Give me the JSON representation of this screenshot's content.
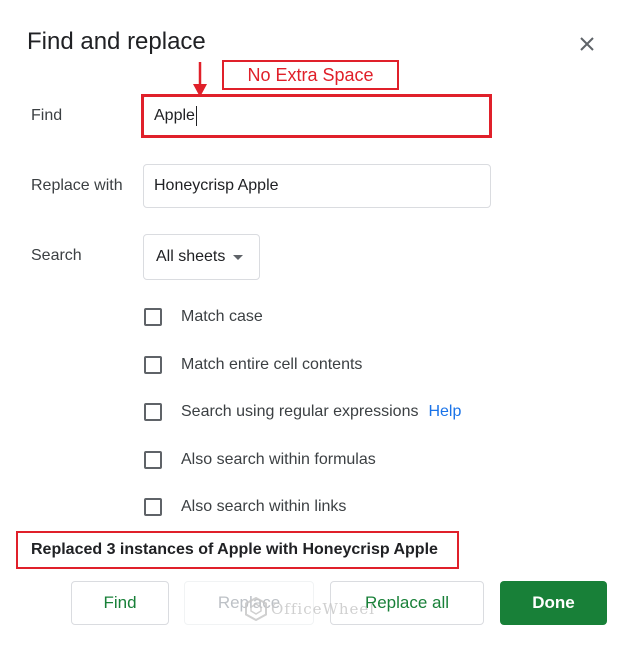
{
  "dialog": {
    "title": "Find and replace",
    "close_icon": "close-icon"
  },
  "find": {
    "label": "Find",
    "value": "Apple"
  },
  "replace": {
    "label": "Replace with",
    "value": "Honeycrisp Apple"
  },
  "search": {
    "label": "Search",
    "selected": "All sheets",
    "icon": "dropdown-arrow-icon"
  },
  "options": [
    {
      "label": "Match case",
      "checked": false
    },
    {
      "label": "Match entire cell contents",
      "checked": false
    },
    {
      "label": "Search using regular expressions",
      "checked": false,
      "link": "Help"
    },
    {
      "label": "Also search within formulas",
      "checked": false
    },
    {
      "label": "Also search within links",
      "checked": false
    }
  ],
  "status": "Replaced 3 instances of Apple with Honeycrisp Apple",
  "buttons": {
    "find": "Find",
    "replace": "Replace",
    "replace_all": "Replace all",
    "done": "Done"
  },
  "annotation": {
    "text": "No Extra Space",
    "color": "#e0202a"
  },
  "watermark": {
    "text": "OfficeWheel"
  },
  "colors": {
    "accent": "#188038",
    "link": "#1a73e8",
    "annotation": "#e0202a"
  }
}
